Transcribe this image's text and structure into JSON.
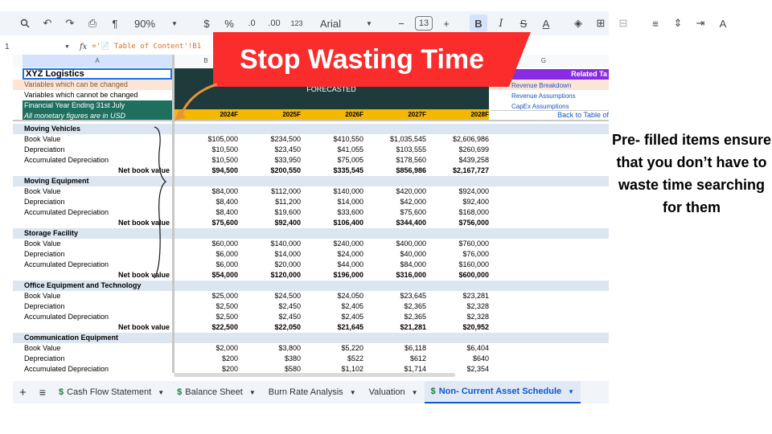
{
  "toolbar": {
    "zoom": "90%",
    "currency_symbol": "$",
    "percent_symbol": "%",
    "decrease_decimals": ".0",
    "increase_decimals": ".00",
    "number_format": "123",
    "font": "Arial",
    "font_size": "13",
    "bold": "B",
    "italic": "I",
    "strikethrough": "S",
    "text_color": "A",
    "minus": "−",
    "plus": "+"
  },
  "formula_bar": {
    "cell_ref": "1",
    "fx": "fx",
    "formula": "='📄 Table of Content'!B1"
  },
  "columns": {
    "A": "A",
    "B": "B",
    "G": "G"
  },
  "header": {
    "company": "XYZ Logistics",
    "var_changed": "Variables which can be changed",
    "var_not_changed": "Variables which cannot be changed",
    "fiscal_year": "Financial Year Ending 31st July",
    "currency_note": "All monetary figures are in USD",
    "forecasted": "FORECASTED",
    "years": [
      "2024F",
      "2025F",
      "2026F",
      "2027F",
      "2028F"
    ]
  },
  "related": {
    "title": "Related Ta",
    "links": [
      "Revenue Breakdown",
      "Revenue Assumptions",
      "CapEx Assumptions"
    ],
    "back": "Back to Table of"
  },
  "sections": [
    {
      "name": "Moving Vehicles",
      "rows": [
        {
          "label": "Book Value",
          "values": [
            "$105,000",
            "$234,500",
            "$410,550",
            "$1,035,545",
            "$2,606,986"
          ]
        },
        {
          "label": "Depreciation",
          "values": [
            "$10,500",
            "$23,450",
            "$41,055",
            "$103,555",
            "$260,699"
          ]
        },
        {
          "label": "Accumulated Depreciation",
          "values": [
            "$10,500",
            "$33,950",
            "$75,005",
            "$178,560",
            "$439,258"
          ]
        },
        {
          "label": "Net book value",
          "values": [
            "$94,500",
            "$200,550",
            "$335,545",
            "$856,986",
            "$2,167,727"
          ]
        }
      ]
    },
    {
      "name": "Moving Equipment",
      "rows": [
        {
          "label": "Book Value",
          "values": [
            "$84,000",
            "$112,000",
            "$140,000",
            "$420,000",
            "$924,000"
          ]
        },
        {
          "label": "Depreciation",
          "values": [
            "$8,400",
            "$11,200",
            "$14,000",
            "$42,000",
            "$92,400"
          ]
        },
        {
          "label": "Accumulated Depreciation",
          "values": [
            "$8,400",
            "$19,600",
            "$33,600",
            "$75,600",
            "$168,000"
          ]
        },
        {
          "label": "Net book value",
          "values": [
            "$75,600",
            "$92,400",
            "$106,400",
            "$344,400",
            "$756,000"
          ]
        }
      ]
    },
    {
      "name": "Storage Facility",
      "rows": [
        {
          "label": "Book Value",
          "values": [
            "$60,000",
            "$140,000",
            "$240,000",
            "$400,000",
            "$760,000"
          ]
        },
        {
          "label": "Depreciation",
          "values": [
            "$6,000",
            "$14,000",
            "$24,000",
            "$40,000",
            "$76,000"
          ]
        },
        {
          "label": "Accumulated Depreciation",
          "values": [
            "$6,000",
            "$20,000",
            "$44,000",
            "$84,000",
            "$160,000"
          ]
        },
        {
          "label": "Net book value",
          "values": [
            "$54,000",
            "$120,000",
            "$196,000",
            "$316,000",
            "$600,000"
          ]
        }
      ]
    },
    {
      "name": "Office Equipment and Technology",
      "rows": [
        {
          "label": "Book Value",
          "values": [
            "$25,000",
            "$24,500",
            "$24,050",
            "$23,645",
            "$23,281"
          ]
        },
        {
          "label": "Depreciation",
          "values": [
            "$2,500",
            "$2,450",
            "$2,405",
            "$2,365",
            "$2,328"
          ]
        },
        {
          "label": "Accumulated Depreciation",
          "values": [
            "$2,500",
            "$2,450",
            "$2,405",
            "$2,365",
            "$2,328"
          ]
        },
        {
          "label": "Net book value",
          "values": [
            "$22,500",
            "$22,050",
            "$21,645",
            "$21,281",
            "$20,952"
          ]
        }
      ]
    },
    {
      "name": "Communication Equipment",
      "rows": [
        {
          "label": "Book Value",
          "values": [
            "$2,000",
            "$3,800",
            "$5,220",
            "$6,118",
            "$6,404"
          ]
        },
        {
          "label": "Depreciation",
          "values": [
            "$200",
            "$380",
            "$522",
            "$612",
            "$640"
          ]
        },
        {
          "label": "Accumulated Depreciation",
          "values": [
            "$200",
            "$580",
            "$1,102",
            "$1,714",
            "$2,354"
          ]
        }
      ]
    }
  ],
  "tabs": {
    "add": "+",
    "menu": "≡",
    "items": [
      "Cash Flow Statement",
      "Balance Sheet",
      "Burn Rate Analysis",
      "Valuation",
      "Non- Current Asset Schedule"
    ]
  },
  "banner": {
    "text": "Stop Wasting Time",
    "color": "#fb2c2c"
  },
  "side_note": "Pre- filled items ensure that you don’t have to waste time searching for them",
  "colors": {
    "gold": "#f5b800",
    "dark_teal": "#1f3a3a",
    "section_bg": "#dce6f1",
    "purple": "#8a2be2",
    "active_tab": "#0b57d0"
  }
}
